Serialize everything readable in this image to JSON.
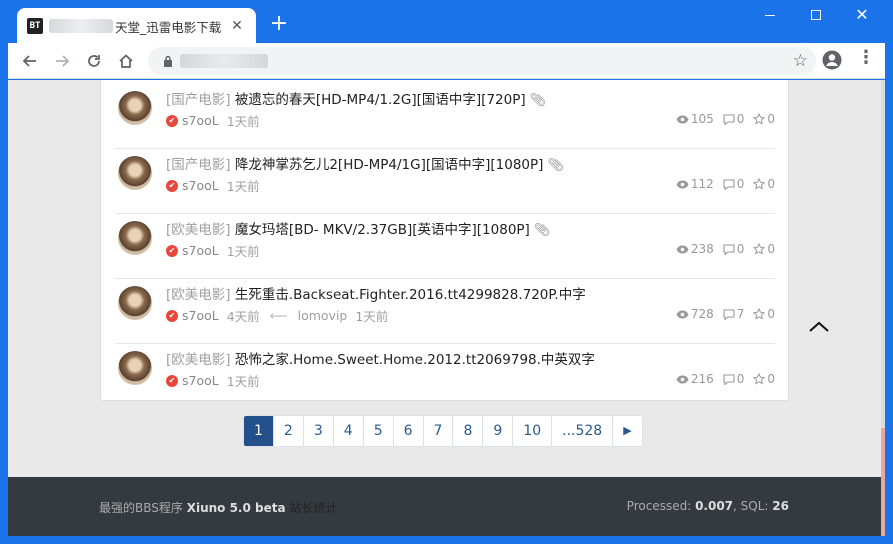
{
  "browser": {
    "favicon_text": "BT",
    "tab_title": "天堂_迅雷电影下载",
    "new_tab": "+",
    "close_tab": "✕",
    "win_close": "✕",
    "menu": "⋮",
    "star": "☆"
  },
  "threads": [
    {
      "category": "[国产电影]",
      "title": "被遗忘的春天[HD-MP4/1.2G][国语中字][720P]",
      "attachment": true,
      "author": "s7ooL",
      "time": "1天前",
      "last_user": "",
      "last_time": "",
      "views": "105",
      "replies": "0",
      "likes": "0"
    },
    {
      "category": "[国产电影]",
      "title": "降龙神掌苏乞儿2[HD-MP4/1G][国语中字][1080P]",
      "attachment": true,
      "author": "s7ooL",
      "time": "1天前",
      "last_user": "",
      "last_time": "",
      "views": "112",
      "replies": "0",
      "likes": "0"
    },
    {
      "category": "[欧美电影]",
      "title": "魔女玛塔[BD- MKV/2.37GB][英语中字][1080P]",
      "attachment": true,
      "author": "s7ooL",
      "time": "1天前",
      "last_user": "",
      "last_time": "",
      "views": "238",
      "replies": "0",
      "likes": "0"
    },
    {
      "category": "[欧美电影]",
      "title": "生死重击.Backseat.Fighter.2016.tt4299828.720P.中字",
      "attachment": false,
      "author": "s7ooL",
      "time": "4天前",
      "last_user": "lomovip",
      "last_time": "1天前",
      "views": "728",
      "replies": "7",
      "likes": "0"
    },
    {
      "category": "[欧美电影]",
      "title": "恐怖之家.Home.Sweet.Home.2012.tt2069798.中英双字",
      "attachment": false,
      "author": "s7ooL",
      "time": "1天前",
      "last_user": "",
      "last_time": "",
      "views": "216",
      "replies": "0",
      "likes": "0"
    }
  ],
  "pagination": {
    "pages": [
      "1",
      "2",
      "3",
      "4",
      "5",
      "6",
      "7",
      "8",
      "9",
      "10",
      "...528"
    ],
    "active": "1",
    "next": "▶"
  },
  "footer": {
    "prefix": "最强的BBS程序",
    "product": "Xiuno 5.0 beta",
    "stats_link": "站长统计",
    "processed_label": "Processed:",
    "processed_value": "0.007",
    "sql_label": ", SQL:",
    "sql_value": "26"
  },
  "icons": {
    "views": "eye-icon",
    "replies": "comment-icon",
    "likes": "star-icon",
    "attachment": "paperclip-icon",
    "verified": "verified-badge-icon"
  },
  "colors": {
    "chrome_blue": "#1a73e8",
    "active_page": "#23508a",
    "footer_bg": "#343a40",
    "badge_red": "#e8483b"
  }
}
